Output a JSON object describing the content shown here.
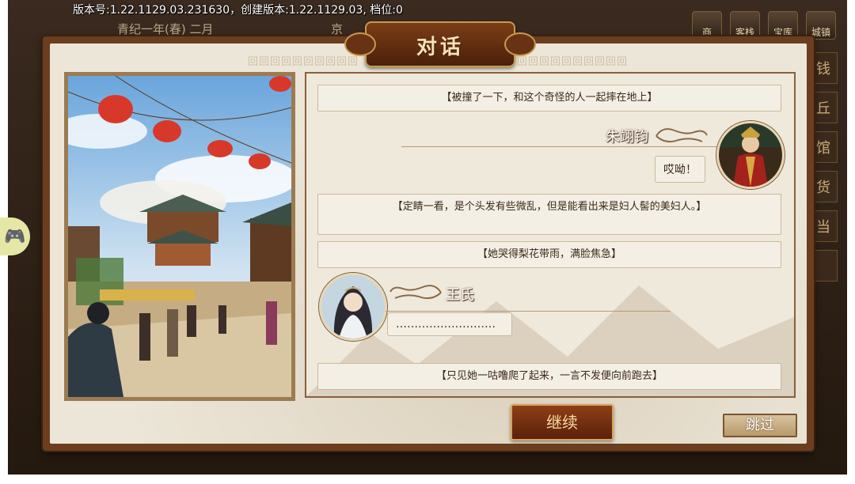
{
  "version_info": "版本号:1.22.1129.03.231630，创建版本:1.22.1129.03, 档位:0",
  "topbar": {
    "date": "青纪一年(春) 二月",
    "city": "京"
  },
  "top_icons": [
    "商",
    "客栈",
    "宝库",
    "城镇"
  ],
  "side_icons": [
    "钱",
    "丘",
    "馆",
    "货",
    "当",
    ""
  ],
  "dialog": {
    "title": "对话",
    "greek_pattern": "回回回回回回回回回回回回"
  },
  "messages": {
    "n1": "【被撞了一下，和这个奇怪的人一起摔在地上】",
    "speaker1": {
      "name": "朱翊钧",
      "line": "哎呦！"
    },
    "n2": "【定睛一看，是个头发有些微乱，但是能看出来是妇人髻的美妇人。】",
    "n3": "【她哭得梨花带雨，满脸焦急】",
    "speaker2": {
      "name": "王氏",
      "line": "………………………"
    },
    "n4": "【只见她一咕噜爬了起来，一言不发便向前跑去】"
  },
  "buttons": {
    "continue": "继续",
    "skip": "跳过"
  },
  "colors": {
    "frame": "#6b3e1f",
    "panel_bg": "#ece6d8",
    "button_red": "#8e3f17",
    "gold": "#d6a45a"
  },
  "icons": {
    "gamepad": "gamepad-icon"
  }
}
